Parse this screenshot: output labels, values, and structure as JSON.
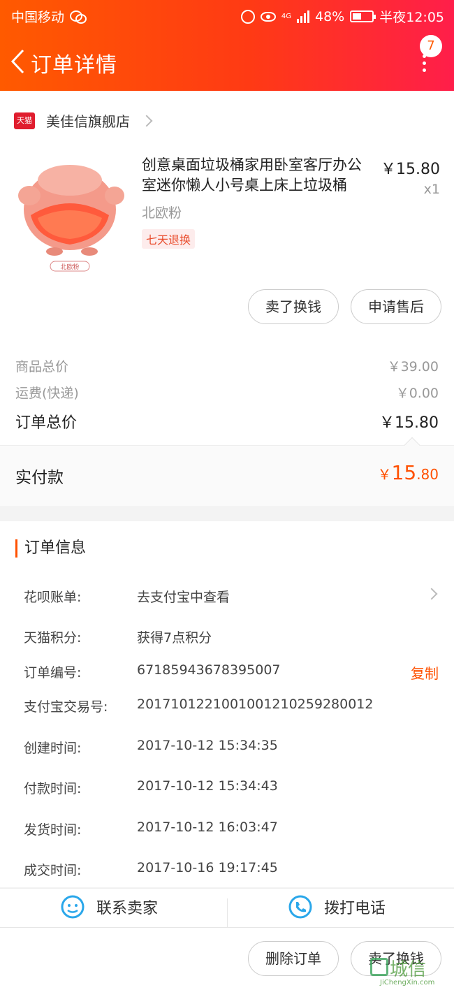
{
  "status_bar": {
    "carrier": "中国移动",
    "network": "4G",
    "battery": "48%",
    "time": "半夜12:05"
  },
  "header": {
    "title": "订单详情",
    "badge_count": "7"
  },
  "shop": {
    "logo_text": "天猫",
    "name": "美佳信旗舰店"
  },
  "product": {
    "title": "创意桌面垃圾桶家用卧室客厅办公室迷你懒人小号桌上床上垃圾桶",
    "price": "￥15.80",
    "qty": "x1",
    "spec": "北欧粉",
    "image_label": "北欧粉",
    "tag": "七天退换"
  },
  "actions": {
    "sell_button": "卖了换钱",
    "aftersale_button": "申请售后"
  },
  "summary": {
    "goods_label": "商品总价",
    "goods_value": "￥39.00",
    "shipping_label": "运费(快递)",
    "shipping_value": "￥0.00",
    "order_total_label": "订单总价",
    "order_total_value": "￥15.80",
    "paid_label": "实付款",
    "paid_currency": "￥",
    "paid_int": "15",
    "paid_dec": ".80"
  },
  "order_info": {
    "title": "订单信息",
    "huabei_label": "花呗账单:",
    "huabei_value": "去支付宝中查看",
    "points_label": "天猫积分:",
    "points_value": "获得7点积分",
    "order_no_label": "订单编号:",
    "order_no_value": "67185943678395007",
    "copy_label": "复制",
    "alipay_label": "支付宝交易号:",
    "alipay_value": "2017101221001001210259280012",
    "created_label": "创建时间:",
    "created_value": "2017-10-12 15:34:35",
    "paid_label": "付款时间:",
    "paid_value": "2017-10-12 15:34:43",
    "shipped_label": "发货时间:",
    "shipped_value": "2017-10-12 16:03:47",
    "closed_label": "成交时间:",
    "closed_value": "2017-10-16 19:17:45"
  },
  "contact": {
    "seller_label": "联系卖家",
    "phone_label": "拨打电话"
  },
  "bottom": {
    "delete_button": "删除订单",
    "sell_button": "卖了换钱"
  },
  "watermark": {
    "text": "城信",
    "sub": "JiChengXin.com"
  },
  "colors": {
    "accent": "#ff5000",
    "header_start": "#ff5a00",
    "header_end": "#ff1e4a",
    "tmall_red": "#e01d2e",
    "icon_blue": "#2aa7ea"
  }
}
